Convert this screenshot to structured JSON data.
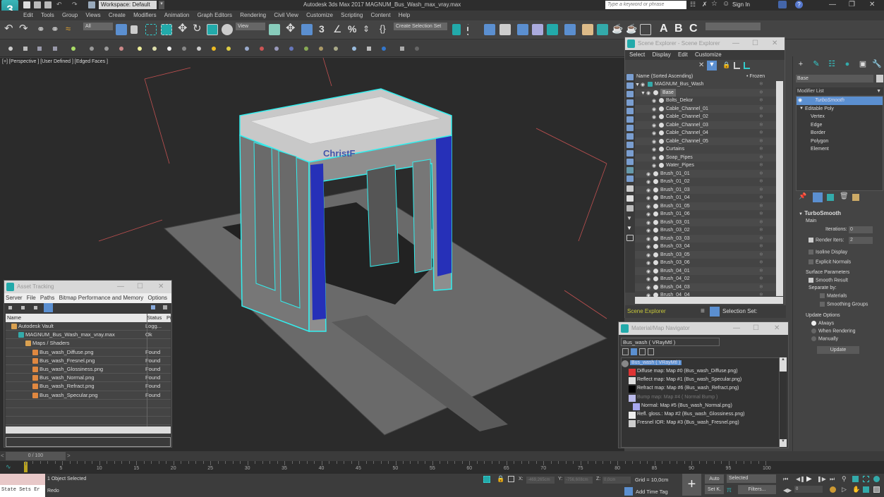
{
  "titlebar": {
    "workspace": "Workspace: Default",
    "app_title": "Autodesk 3ds Max 2017     MAGNUM_Bus_Wash_max_vray.max",
    "search_placeholder": "Type a keyword or phrase",
    "sign_in": "Sign In"
  },
  "menu": [
    "Edit",
    "Tools",
    "Group",
    "Views",
    "Create",
    "Modifiers",
    "Animation",
    "Graph Editors",
    "Rendering",
    "Civil View",
    "Customize",
    "Scripting",
    "Content",
    "Help"
  ],
  "toolbar": {
    "selection_filter": "All",
    "ref_coord": "View",
    "selection_set": "Create Selection Set",
    "abc_labels": [
      "A",
      "B",
      "C"
    ]
  },
  "viewport": {
    "label": "[+] [Perspective ] [User Defined ] [Edged Faces ]",
    "sign_text": "ChristF"
  },
  "scene_explorer": {
    "title": "Scene Explorer - Scene Explorer",
    "menu": [
      "Select",
      "Display",
      "Edit",
      "Customize"
    ],
    "col_name": "Name (Sorted Ascending)",
    "col_frozen": "• Frozen",
    "rows": [
      {
        "name": "MAGNUM_Bus_Wash",
        "level": 0
      },
      {
        "name": "Base",
        "level": 1,
        "selected": true
      },
      {
        "name": "Bolts_Dekor",
        "level": 2
      },
      {
        "name": "Cable_Channel_01",
        "level": 2
      },
      {
        "name": "Cable_Channel_02",
        "level": 2
      },
      {
        "name": "Cable_Channel_03",
        "level": 2
      },
      {
        "name": "Cable_Channel_04",
        "level": 2
      },
      {
        "name": "Cable_Channel_05",
        "level": 2
      },
      {
        "name": "Curtains",
        "level": 2
      },
      {
        "name": "Soap_Pipes",
        "level": 2
      },
      {
        "name": "Water_Pipes",
        "level": 2
      },
      {
        "name": "Brush_01_01",
        "level": 1
      },
      {
        "name": "Brush_01_02",
        "level": 1
      },
      {
        "name": "Brush_01_03",
        "level": 1
      },
      {
        "name": "Brush_01_04",
        "level": 1
      },
      {
        "name": "Brush_01_05",
        "level": 1
      },
      {
        "name": "Brush_01_06",
        "level": 1
      },
      {
        "name": "Brush_03_01",
        "level": 1
      },
      {
        "name": "Brush_03_02",
        "level": 1
      },
      {
        "name": "Brush_03_03",
        "level": 1
      },
      {
        "name": "Brush_03_04",
        "level": 1
      },
      {
        "name": "Brush_03_05",
        "level": 1
      },
      {
        "name": "Brush_03_06",
        "level": 1
      },
      {
        "name": "Brush_04_01",
        "level": 1
      },
      {
        "name": "Brush_04_02",
        "level": 1
      },
      {
        "name": "Brush_04_03",
        "level": 1
      },
      {
        "name": "Brush_04_04",
        "level": 1
      }
    ],
    "footer_label": "Scene Explorer",
    "selection_set": "Selection Set:"
  },
  "command_panel": {
    "object_name": "Base",
    "modifier_list": "Modifier List",
    "stack": [
      "TurboSmooth",
      "Editable Poly",
      "Vertex",
      "Edge",
      "Border",
      "Polygon",
      "Element"
    ],
    "turbosmooth": {
      "title": "TurboSmooth",
      "main": "Main",
      "iterations_label": "Iterations:",
      "iterations": "0",
      "render_iters_label": "Render Iters:",
      "render_iters": "2",
      "isoline": "Isoline Display",
      "explicit_normals": "Explicit Normals",
      "surface_params": "Surface Parameters",
      "smooth_result": "Smooth Result",
      "separate_by": "Separate by:",
      "materials": "Materials",
      "smoothing_groups": "Smoothing Groups",
      "update_options": "Update Options",
      "always": "Always",
      "when_rendering": "When Rendering",
      "manually": "Manually",
      "update_btn": "Update"
    }
  },
  "asset_tracking": {
    "title": "Asset Tracking",
    "menu": [
      "Server",
      "File",
      "Paths",
      "Bitmap Performance and Memory",
      "Options"
    ],
    "col_name": "Name",
    "col_status": "Status",
    "col_extra": "Pr",
    "rows": [
      {
        "name": "Autodesk Vault",
        "status": "Logg...",
        "level": 0,
        "icon": "vault"
      },
      {
        "name": "MAGNUM_Bus_Wash_max_vray.max",
        "status": "Ok",
        "level": 1,
        "icon": "max"
      },
      {
        "name": "Maps / Shaders",
        "status": "",
        "level": 2,
        "icon": "folder"
      },
      {
        "name": "Bus_wash_Diffuse.png",
        "status": "Found",
        "level": 3,
        "icon": "image"
      },
      {
        "name": "Bus_wash_Fresnel.png",
        "status": "Found",
        "level": 3,
        "icon": "image"
      },
      {
        "name": "Bus_wash_Glossiness.png",
        "status": "Found",
        "level": 3,
        "icon": "image"
      },
      {
        "name": "Bus_wash_Normal.png",
        "status": "Found",
        "level": 3,
        "icon": "image"
      },
      {
        "name": "Bus_wash_Refract.png",
        "status": "Found",
        "level": 3,
        "icon": "image"
      },
      {
        "name": "Bus_wash_Specular.png",
        "status": "Found",
        "level": 3,
        "icon": "image"
      }
    ]
  },
  "material_navigator": {
    "title": "Material/Map Navigator",
    "field": "Bus_wash  ( VRayMtl )",
    "root": "Bus_wash  ( VRayMtl )",
    "maps": [
      {
        "label": "Diffuse map: Map #0 (Bus_wash_Diffuse.png)",
        "indent": 1,
        "dim": false,
        "swatch": "#d33"
      },
      {
        "label": "Reflect map: Map #1 (Bus_wash_Specular.png)",
        "indent": 1,
        "dim": false,
        "swatch": "#ddd"
      },
      {
        "label": "Refract map: Map #6 (Bus_wash_Refract.png)",
        "indent": 1,
        "dim": false,
        "swatch": "#000"
      },
      {
        "label": "Bump map: Map #4  ( Normal Bump )",
        "indent": 1,
        "dim": true,
        "swatch": "#b8b8e8"
      },
      {
        "label": "Normal: Map #5 (Bus_wash_Normal.png)",
        "indent": 2,
        "dim": false,
        "swatch": "#a8a8f0"
      },
      {
        "label": "Refl. gloss.: Map #2 (Bus_wash_Glossiness.png)",
        "indent": 1,
        "dim": false,
        "swatch": "#eee"
      },
      {
        "label": "Fresnel IOR: Map #3 (Bus_wash_Fresnel.png)",
        "indent": 1,
        "dim": false,
        "swatch": "#ccc"
      }
    ]
  },
  "timeline": {
    "frame": "0 / 100",
    "current_frame": 0,
    "total_frames": 100,
    "ticks": [
      "0",
      "5",
      "10",
      "15",
      "20",
      "25",
      "30",
      "35",
      "40",
      "45",
      "50",
      "55",
      "60",
      "65",
      "70",
      "75",
      "80",
      "85",
      "90",
      "95",
      "100"
    ]
  },
  "status": {
    "maxscript_label": "State Sets Er",
    "selection": "1 Object Selected",
    "prompt": "Redo",
    "x": "-469,265cm",
    "y": "-756,608cm",
    "z": "0,0cm",
    "grid": "Grid = 10,0cm",
    "add_time_tag": "Add Time Tag",
    "auto": "Auto",
    "setk": "Set K.",
    "key_filter": "Selected",
    "filters": "Filters...",
    "frame_spinner": "0"
  }
}
